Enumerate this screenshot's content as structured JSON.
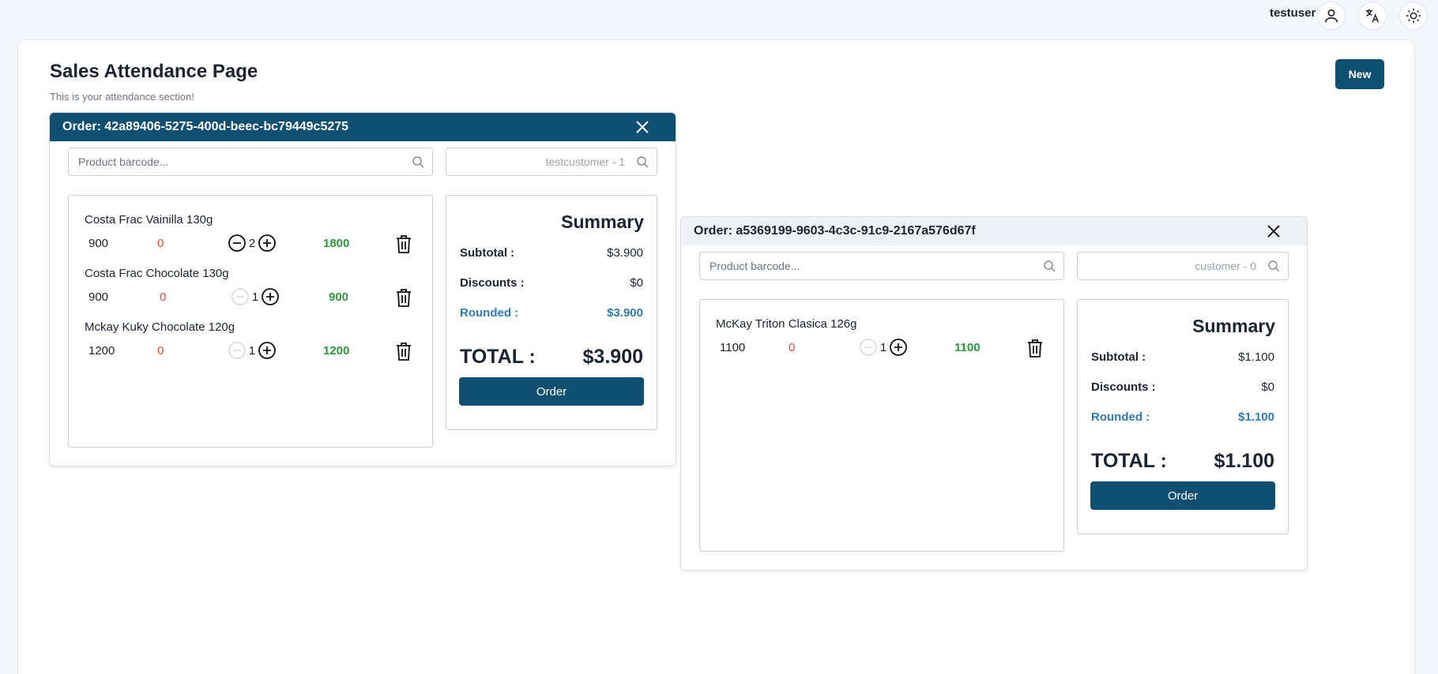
{
  "header": {
    "username": "testuser",
    "icons": [
      "user-icon",
      "translate-icon",
      "sun-icon"
    ]
  },
  "page": {
    "title": "Sales Attendance Page",
    "subtitle": "This is your attendance section!",
    "new_label": "New"
  },
  "orders": [
    {
      "title": "Order: 42a89406-5275-400d-beec-bc79449c5275",
      "barcode_placeholder": "Product barcode...",
      "customer_placeholder": "testcustomer - 1",
      "items": [
        {
          "name": "Costa Frac Vainilla 130g",
          "price": "900",
          "discount": "0",
          "qty": "2",
          "total": "1800",
          "minus_enabled": true
        },
        {
          "name": "Costa Frac Chocolate 130g",
          "price": "900",
          "discount": "0",
          "qty": "1",
          "total": "900",
          "minus_enabled": false
        },
        {
          "name": "Mckay Kuky Chocolate 120g",
          "price": "1200",
          "discount": "0",
          "qty": "1",
          "total": "1200",
          "minus_enabled": false
        }
      ],
      "summary": {
        "title": "Summary",
        "subtotal_label": "Subtotal :",
        "subtotal": "$3.900",
        "discounts_label": "Discounts :",
        "discounts": "$0",
        "rounded_label": "Rounded :",
        "rounded": "$3.900",
        "total_label": "TOTAL :",
        "total": "$3.900",
        "order_label": "Order"
      }
    },
    {
      "title": "Order: a5369199-9603-4c3c-91c9-2167a576d67f",
      "barcode_placeholder": "Product barcode...",
      "customer_placeholder": "customer - 0",
      "items": [
        {
          "name": "McKay Triton Clasica 126g",
          "price": "1100",
          "discount": "0",
          "qty": "1",
          "total": "1100",
          "minus_enabled": false
        }
      ],
      "summary": {
        "title": "Summary",
        "subtotal_label": "Subtotal :",
        "subtotal": "$1.100",
        "discounts_label": "Discounts :",
        "discounts": "$0",
        "rounded_label": "Rounded :",
        "rounded": "$1.100",
        "total_label": "TOTAL :",
        "total": "$1.100",
        "order_label": "Order"
      }
    }
  ],
  "colors": {
    "primary": "#0f4f71",
    "discount": "#e04b3b",
    "line_total": "#2a9a3b",
    "rounded": "#2c7bb6"
  }
}
